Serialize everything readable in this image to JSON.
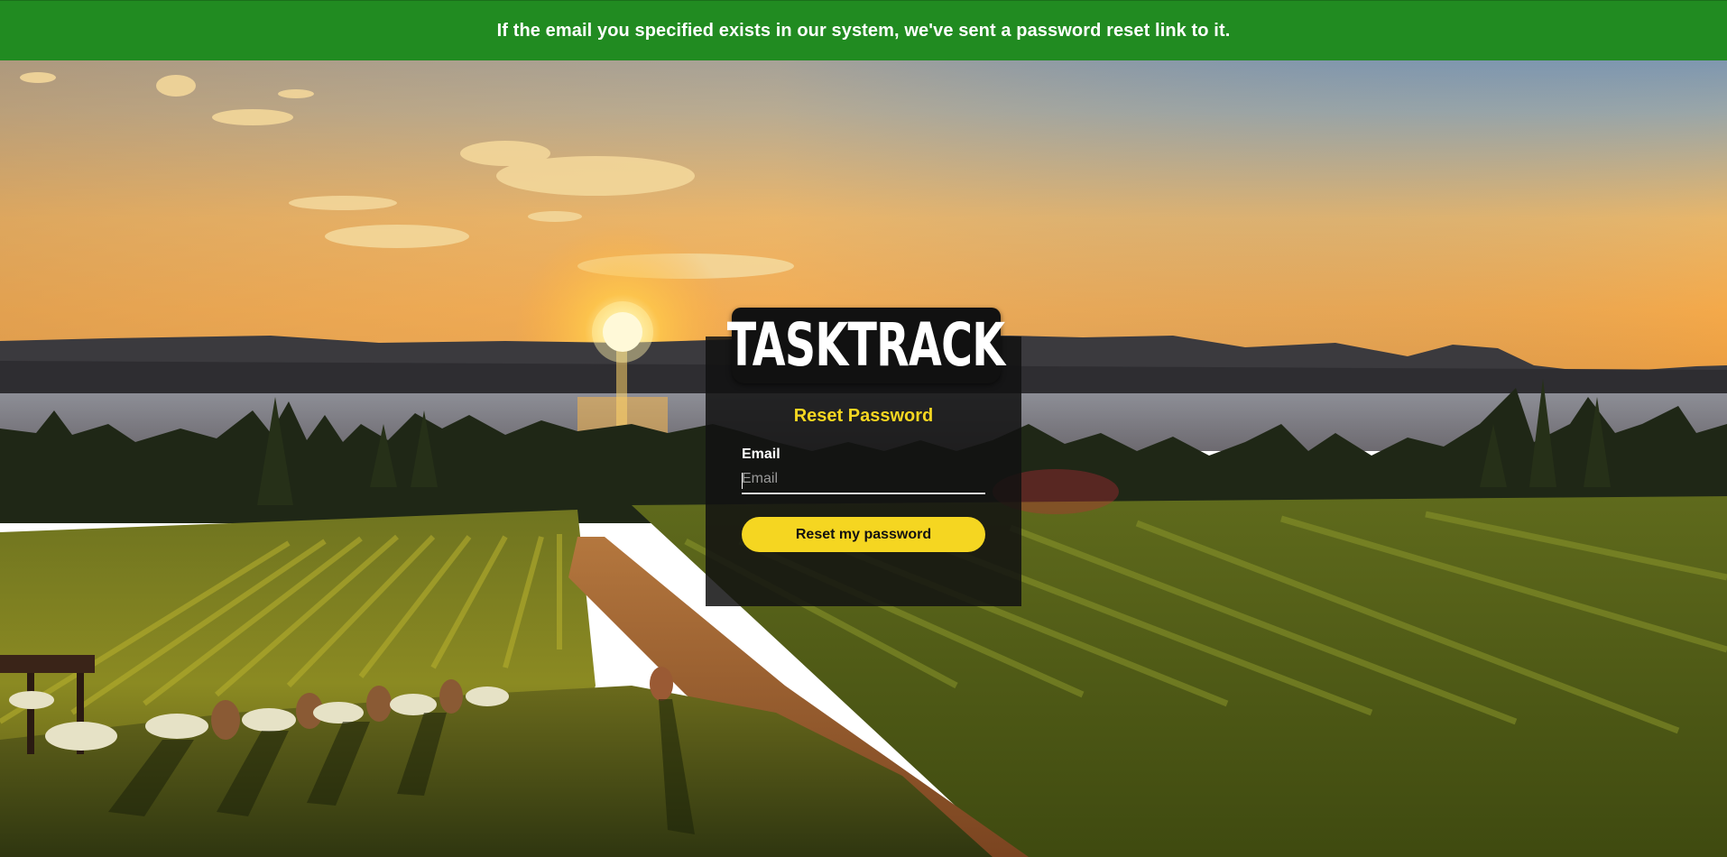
{
  "banner": {
    "message": "If the email you specified exists in our system, we've sent a password reset link to it.",
    "color": "#218b21"
  },
  "brand": {
    "logo_text": "TASKTRACK"
  },
  "form": {
    "title": "Reset Password",
    "email_label": "Email",
    "email_placeholder": "Email",
    "email_value": "",
    "submit_label": "Reset my password",
    "accent_color": "#f5d621"
  },
  "background": {
    "scene": "vineyard-sunset-lake-photo"
  }
}
